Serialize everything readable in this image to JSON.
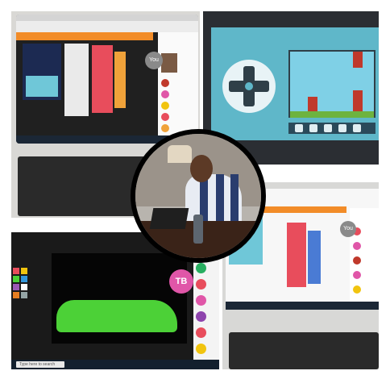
{
  "panels": {
    "top_left": {
      "avatar_label": "You"
    },
    "bottom_left": {
      "avatar_initials": "TB",
      "taskbar_search": "Type here to search"
    },
    "bottom_right": {
      "avatar_label": "You"
    }
  },
  "colors": {
    "orange_app_bar": "#f28c28",
    "code_block_red": "#e84d5c",
    "game_bg": "#5fb7c9",
    "grass_green": "#4cd137",
    "tb_avatar": "#e056a8",
    "photo_frame": "#000000"
  }
}
